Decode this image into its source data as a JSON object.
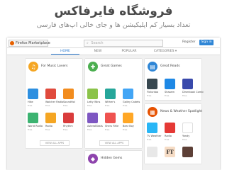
{
  "slide": {
    "title": "فروشگاه فایرفاکس",
    "subtitle": "تعداد بسیار کم اپلیکیشن ها و جای خالی اپ‌های فارسی"
  },
  "screenshot": {
    "topbar": {
      "logo_label": "Firefox Marketplace",
      "search_placeholder": "Search",
      "register_label": "Register",
      "signin_label": "Sign in"
    },
    "nav": {
      "tabs": [
        "HOME",
        "NEW",
        "POPULAR",
        "CATEGORIES ▾"
      ],
      "active_tab": "HOME"
    },
    "cards": [
      {
        "title": "For Music Lovers",
        "icon": "music-note-icon",
        "color": "#f5a623",
        "apps": [
          {
            "name": "Hike",
            "price": "Free",
            "color": "#2d8fe0"
          },
          {
            "name": "Wolcher Radio",
            "price": "Free",
            "color": "#e04a3c"
          },
          {
            "name": "SoundHol",
            "price": "Free",
            "color": "#f28c1e"
          },
          {
            "name": "World Radio",
            "price": "Free",
            "color": "#3cb371"
          },
          {
            "name": "Radio",
            "price": "Free",
            "color": "#f5a623"
          },
          {
            "name": "Rhythm",
            "price": "Free",
            "color": "#d93c3c"
          }
        ],
        "see_all": "VIEW ALL APPS"
      },
      {
        "title": "Great Games",
        "icon": "game-controller-icon",
        "color": "#4caf50",
        "apps": [
          {
            "name": "Letty Wins",
            "price": "Free",
            "color": "#8bc34a"
          },
          {
            "name": "Wither's",
            "price": "Free",
            "color": "#26a69a"
          },
          {
            "name": "Galley Cadets",
            "price": "Free",
            "color": "#42a5f5"
          },
          {
            "name": "AsteroBlasts",
            "price": "Free",
            "color": "#7e57c2"
          },
          {
            "name": "Sheru Rhle",
            "price": "Free",
            "color": "#ef5350"
          },
          {
            "name": "Bear Boy",
            "price": "Free",
            "color": "#ffa726"
          }
        ],
        "see_all": "VIEW ALL APPS"
      },
      {
        "title": "Great Reads",
        "icon": "book-icon",
        "color": "#2f86d6",
        "apps": [
          {
            "name": "Ficturdoo",
            "price": "Free",
            "color": "#37474f"
          },
          {
            "name": "Shazam",
            "price": "Free",
            "color": "#1e88e5"
          },
          {
            "name": "Dinerbook Comic",
            "price": "Free",
            "color": "#3949ab"
          }
        ],
        "see_all": ""
      },
      {
        "title": "News & Weather Spotlight",
        "icon": "newspaper-icon",
        "color": "#e65100",
        "apps": [
          {
            "name": "TV Weather",
            "price": "Free",
            "color": "#29b6f6"
          },
          {
            "name": "Radio",
            "price": "Free",
            "color": "#e53935"
          },
          {
            "name": "Yandy",
            "price": "Free",
            "color": "#ffffff"
          },
          {
            "name": "",
            "price": "",
            "color": "#e8e8e8"
          },
          {
            "name": "FT",
            "price": "",
            "color": "#f6dcc5"
          },
          {
            "name": "",
            "price": "",
            "color": "#5d4037"
          }
        ],
        "see_all": ""
      },
      {
        "title": "Hidden Gems",
        "icon": "diamond-icon",
        "color": "#8e44ad",
        "apps": [],
        "see_all": ""
      }
    ]
  }
}
